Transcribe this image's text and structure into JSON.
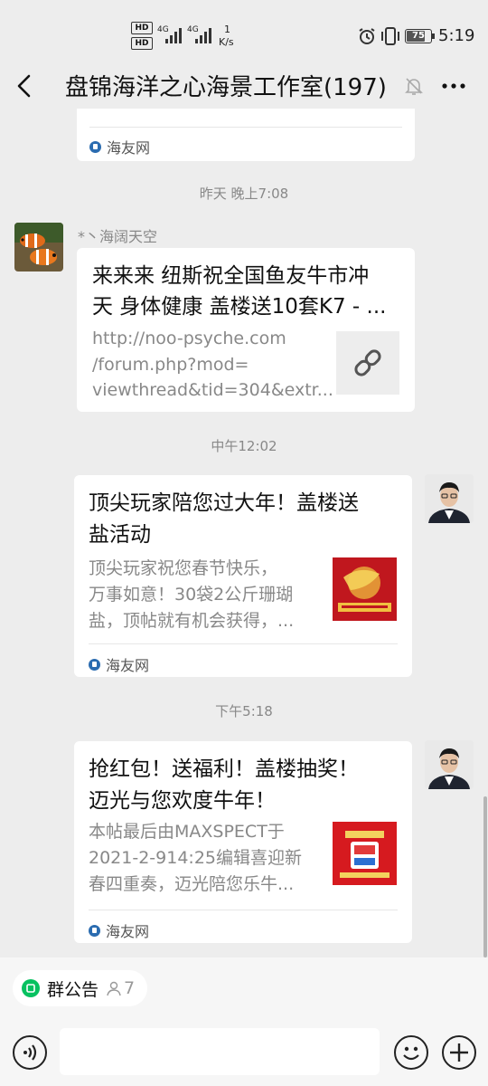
{
  "status": {
    "network_1": "4G",
    "network_2": "4G",
    "speed_value": "1",
    "speed_unit": "K/s",
    "battery": "75",
    "time": "5:19"
  },
  "nav": {
    "title": "盘锦海洋之心海景工作室(197)"
  },
  "messages": {
    "top_card": {
      "source": "海友网"
    },
    "t1": "昨天 晚上7:08",
    "m1": {
      "sender": "*丶海阔天空",
      "title_line1": "来来来 纽斯祝全国鱼友牛市冲",
      "title_line2": "天 身体健康 盖楼送10套K7 - ...",
      "url_line1": "http://noo-psyche.com",
      "url_line2": "/forum.php?mod=",
      "url_line3": "viewthread&tid=304&extr..."
    },
    "t2": "中午12:02",
    "m2": {
      "title_line1": "顶尖玩家陪您过大年！盖楼送",
      "title_line2": "盐活动",
      "desc_line1": "顶尖玩家祝您春节快乐，",
      "desc_line2": "万事如意！30袋2公斤珊瑚",
      "desc_line3": "盐，顶帖就有机会获得，...",
      "source": "海友网"
    },
    "t3": "下午5:18",
    "m3": {
      "title_line1": "抢红包！送福利！盖楼抽奖！",
      "title_line2": "迈光与您欢度牛年！",
      "desc_line1": "本帖最后由MAXSPECT于",
      "desc_line2": "2021-2-914:25编辑喜迎新",
      "desc_line3": "春四重奏，迈光陪您乐牛...",
      "source": "海友网"
    }
  },
  "bottom": {
    "notice_label": "群公告",
    "notice_count": "7"
  },
  "colors": {
    "background": "#ededed",
    "card": "#ffffff",
    "accent_green": "#07c160"
  }
}
